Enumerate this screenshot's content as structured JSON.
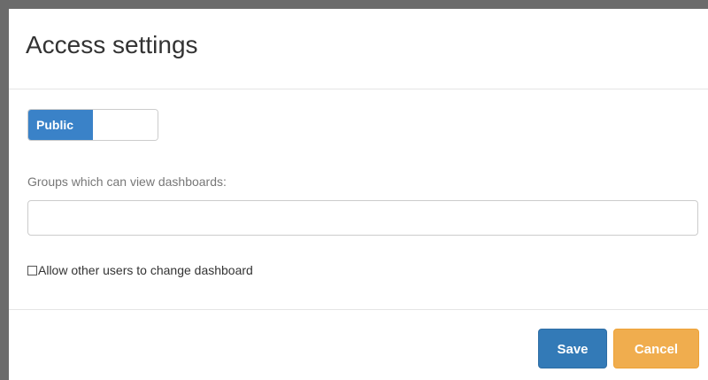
{
  "dialog": {
    "title": "Access settings"
  },
  "visibility_toggle": {
    "active_label": "Public"
  },
  "groups": {
    "label": "Groups which can view dashboards:",
    "value": ""
  },
  "allow_change": {
    "label": "Allow other users to change dashboard",
    "checked": false
  },
  "footer": {
    "save_label": "Save",
    "cancel_label": "Cancel"
  },
  "colors": {
    "primary": "#337ab7",
    "toggle_on": "#3a82c8",
    "warning": "#f0ad4e",
    "window_frame": "#6b6b6b"
  }
}
